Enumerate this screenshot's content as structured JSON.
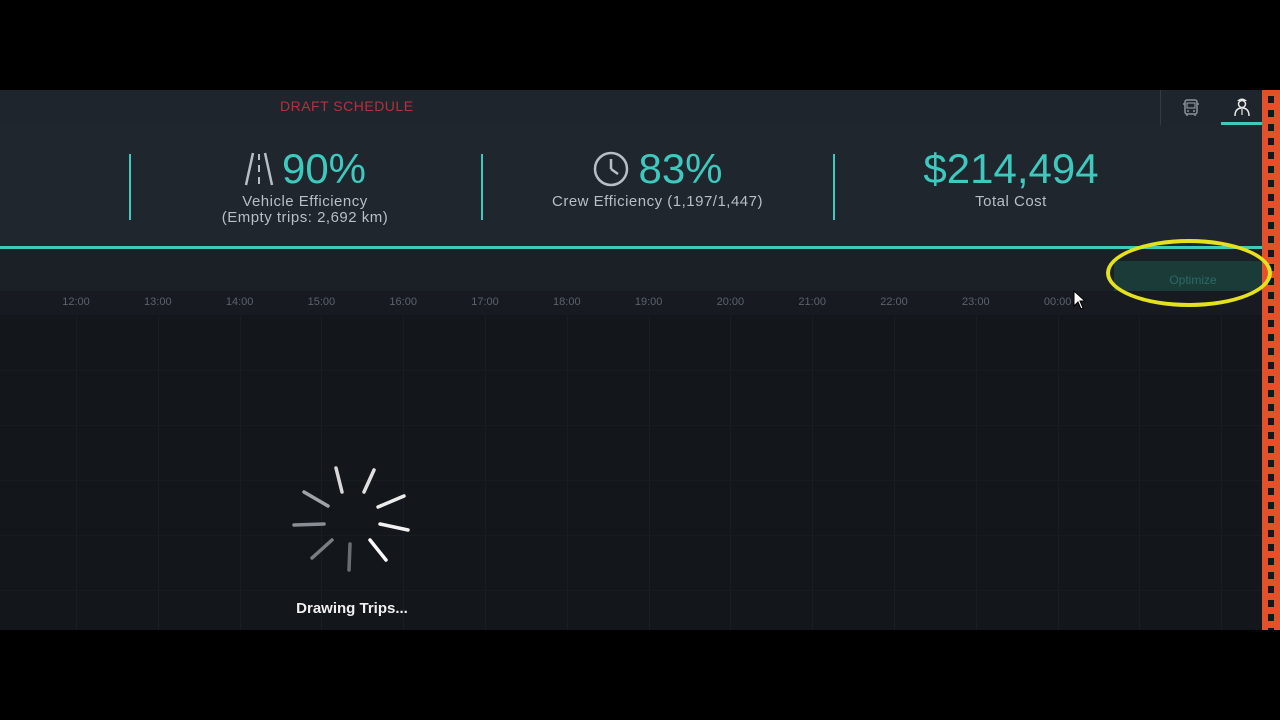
{
  "topbar": {
    "draft_label": "DRAFT SCHEDULE",
    "icons": [
      "bus-icon",
      "crew-member-icon"
    ]
  },
  "kpis": {
    "vehicle": {
      "value": "90%",
      "label": "Vehicle Efficiency",
      "sublabel": "(Empty trips: 2,692 km)",
      "icon": "road-icon"
    },
    "crew": {
      "value": "83%",
      "label": "Crew Efficiency (1,197/1,447)",
      "icon": "clock-icon"
    },
    "cost": {
      "value": "$214,494",
      "label": "Total Cost"
    }
  },
  "optimize_button": {
    "label": "Optimize"
  },
  "timeline": {
    "ticks": [
      "12:00",
      "13:00",
      "14:00",
      "15:00",
      "16:00",
      "17:00",
      "18:00",
      "19:00",
      "20:00",
      "21:00",
      "22:00",
      "23:00",
      "00:00"
    ]
  },
  "loading": {
    "text": "Drawing Trips..."
  },
  "colors": {
    "accent": "#3ec9be",
    "draft": "#b3323c",
    "highlight": "#e4e21f",
    "edge_bar": "#e4502a"
  }
}
